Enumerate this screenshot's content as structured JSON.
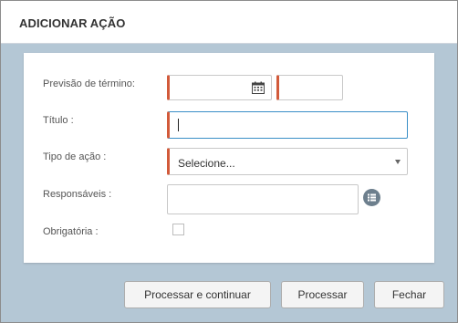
{
  "dialog": {
    "title": "ADICIONAR AÇÃO"
  },
  "form": {
    "previsao_label": "Previsão de término:",
    "titulo_label": "Título :",
    "titulo_value": "",
    "tipo_label": "Tipo de ação :",
    "tipo_selected": "Selecione...",
    "responsaveis_label": "Responsáveis :",
    "obrigatoria_label": "Obrigatória :"
  },
  "icons": {
    "calendar": "calendar-icon",
    "list": "list-icon",
    "dropdown": "chevron-down-icon"
  },
  "buttons": {
    "process_continue": "Processar e continuar",
    "process": "Processar",
    "close": "Fechar"
  },
  "colors": {
    "required_marker": "#d25a3a",
    "focus_border": "#3a8fc7",
    "footer_background": "#b4c7d5"
  }
}
